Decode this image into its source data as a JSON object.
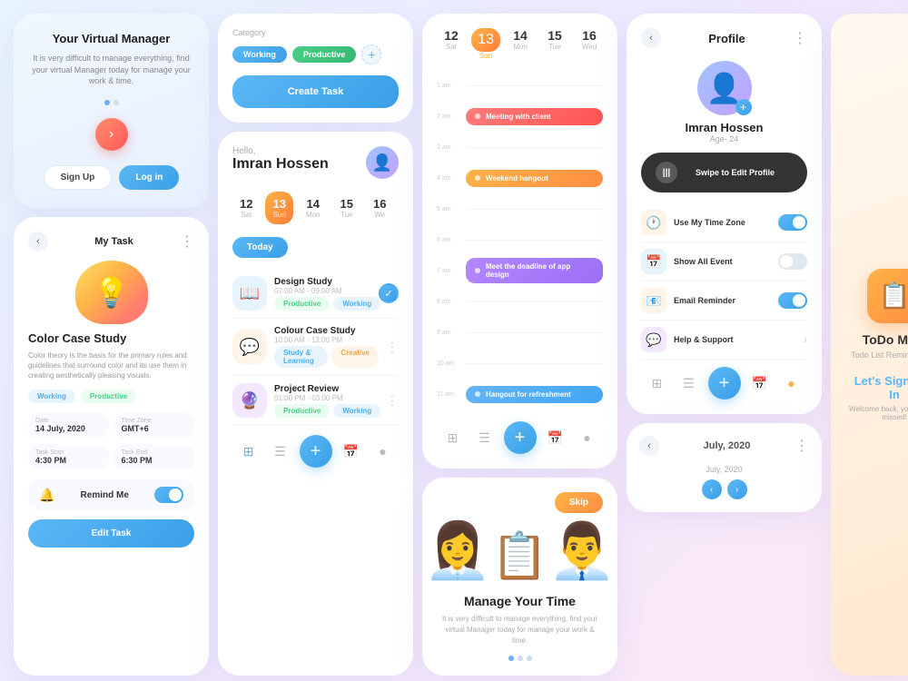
{
  "app": {
    "name": "ToDo Mate",
    "subtitle": "Todo List Reminder App"
  },
  "screen1": {
    "title": "Your Virtual Manager",
    "desc": "It is very difficult to manage everything, find your virtual Manager today for manage your work & time.",
    "signup": "Sign Up",
    "login": "Log in"
  },
  "screen2": {
    "title": "My Task",
    "case_title": "Color Case Study",
    "case_desc": "Color theory is the basis for the primary rules and guidelines that surround color and its use them in creating aesthetically pleasing visuals.",
    "tags": [
      "Working",
      "Productive"
    ],
    "date": "14 July, 2020",
    "timezone": "GMT+6",
    "tz_label": "Time Zone",
    "date_label": "Date",
    "task_start": "4:30 PM",
    "task_end": "6:30 PM",
    "task_start_label": "Task Start",
    "task_end_label": "Task End",
    "remind_label": "Remind Me",
    "edit_btn": "Edit Task"
  },
  "screen3": {
    "category_label": "Category",
    "tags": [
      "Working",
      "Productive"
    ],
    "create_btn": "Create Task",
    "hello": "Hello,",
    "name": "Imran Hossen",
    "today_btn": "Today",
    "dates": [
      {
        "num": "12",
        "day": "Sat",
        "active": false
      },
      {
        "num": "13",
        "day": "Sun",
        "active": true
      },
      {
        "num": "14",
        "day": "Mon",
        "active": false
      },
      {
        "num": "15",
        "day": "Tue",
        "active": false
      },
      {
        "num": "16",
        "day": "We",
        "active": false
      }
    ],
    "tasks": [
      {
        "name": "Design Study",
        "time": "07:00 AM - 09:00 AM",
        "tags": [
          "Productive",
          "Working"
        ],
        "done": true,
        "icon": "📖"
      },
      {
        "name": "Colour Case Study",
        "time": "10:00 AM - 12:00 PM",
        "tags": [
          "Study & Learning",
          "Creative"
        ],
        "done": false,
        "icon": "💬"
      },
      {
        "name": "Project Review",
        "time": "01:00 PM - 03:00 PM",
        "tags": [
          "Productive",
          "Working"
        ],
        "done": false,
        "icon": "🔮"
      }
    ]
  },
  "screen4": {
    "dates": [
      {
        "num": "12",
        "day": "Sat",
        "active": false
      },
      {
        "num": "13",
        "day": "Sun",
        "active": true
      },
      {
        "num": "14",
        "day": "Mon",
        "active": false
      },
      {
        "num": "15",
        "day": "Tue",
        "active": false
      },
      {
        "num": "16",
        "day": "Wed",
        "active": false
      }
    ],
    "events": [
      {
        "time": "1 am",
        "label": "",
        "type": "none"
      },
      {
        "time": "2 am",
        "label": "Meeting with client",
        "type": "red"
      },
      {
        "time": "3 am",
        "label": "",
        "type": "none"
      },
      {
        "time": "4 am",
        "label": "Weekend hangout",
        "type": "orange"
      },
      {
        "time": "5 am",
        "label": "",
        "type": "none"
      },
      {
        "time": "6 am",
        "label": "",
        "type": "none"
      },
      {
        "time": "7 am",
        "label": "Meet the deadline of app design",
        "type": "purple"
      },
      {
        "time": "8 am",
        "label": "",
        "type": "none"
      },
      {
        "time": "9 am",
        "label": "",
        "type": "none"
      },
      {
        "time": "10 am",
        "label": "",
        "type": "none"
      },
      {
        "time": "11 am",
        "label": "Hangout for refreshment",
        "type": "blue"
      }
    ],
    "manage_title": "Manage Your Time",
    "manage_desc": "It is very difficult to manage everything, find your virtual Manager today for manage your work & time.",
    "skip_btn": "Skip"
  },
  "screen5": {
    "profile_title": "Profile",
    "profile_name": "Imran Hossen",
    "profile_age": "Age- 24",
    "swipe_label": "Swipe to Edit Profile",
    "settings": [
      {
        "label": "Use My Time Zone",
        "icon": "🕐",
        "toggle": true
      },
      {
        "label": "Show All Event",
        "icon": "📅",
        "toggle": false
      },
      {
        "label": "Email Reminder",
        "icon": "📧",
        "toggle": true
      },
      {
        "label": "Help & Support",
        "icon": "💬",
        "toggle": false
      }
    ]
  },
  "calendar": {
    "month": "July, 2020",
    "back_btn": "‹",
    "dots_label": "⋮"
  },
  "signin": {
    "title": "Let's Sign You In",
    "subtitle": "Welcome back, you've been missed!"
  }
}
